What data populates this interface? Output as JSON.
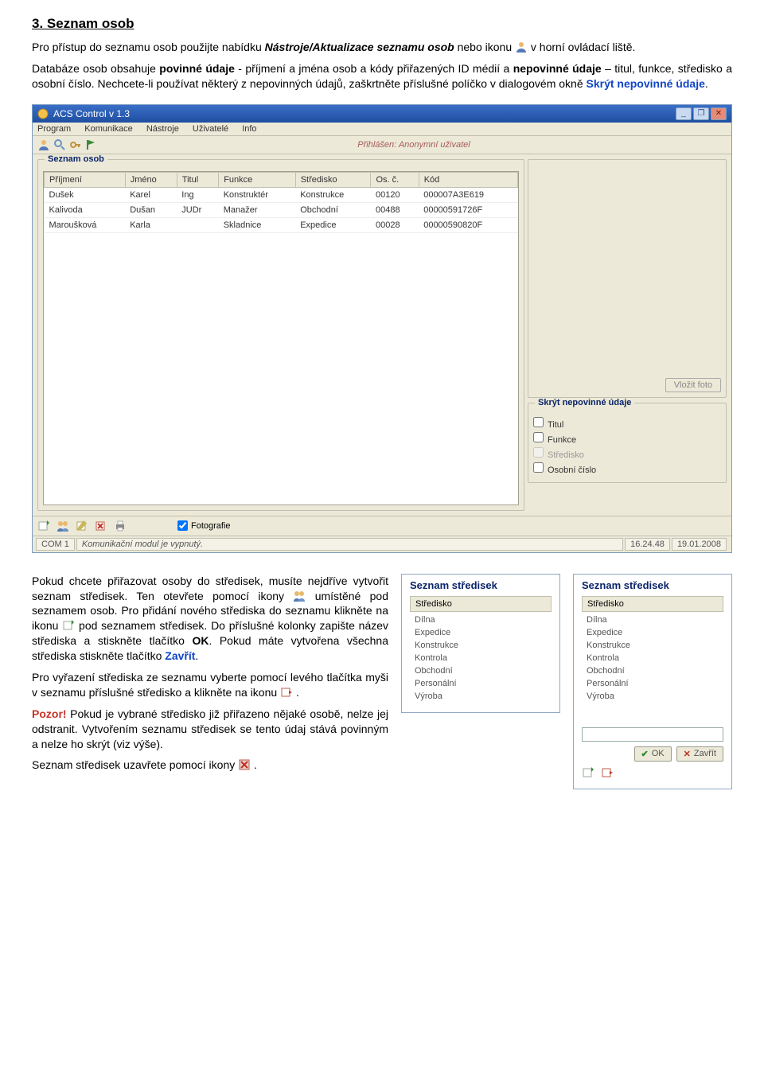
{
  "doc": {
    "heading": "3. Seznam osob",
    "p1a": "Pro přístup do seznamu osob použijte nabídku ",
    "p1menu": "Nástroje/Aktualizace seznamu osob",
    "p1b": " nebo ikonu ",
    "p1c": " v horní ovládací liště.",
    "p2a": "Databáze osob obsahuje ",
    "p2b": "povinné údaje",
    "p2c": " - příjmení a jména osob a kódy přiřazených ID médií a ",
    "p2d": "nepovinné údaje",
    "p2e": " – titul, funkce, středisko a osobní číslo. Nechcete-li používat některý z nepovinných údajů, zaškrtněte příslušné políčko v dialogovém okně ",
    "p2link": "Skrýt nepovinné údaje",
    "p2f": ".",
    "p3a": "Pokud chcete přiřazovat osoby do středisek, musíte nejdříve vytvořit seznam středisek. Ten otevřete pomocí ikony ",
    "p3b": " umístěné pod seznamem osob. Pro přidání nového střediska do seznamu klikněte na ikonu ",
    "p3c": " pod seznamem středisek. Do příslušné kolonky zapište název střediska a stiskněte tlačítko ",
    "p3ok": "OK",
    "p3d": ". Pokud máte vytvořena všechna střediska stiskněte tlačítko ",
    "p3close": "Zavřít",
    "p3e": ".",
    "p4a": "Pro vyřazení střediska ze seznamu vyberte pomocí levého tlačítka myši v seznamu příslušné středisko a klikněte na ikonu ",
    "p4b": ".",
    "p5w": "Pozor!",
    "p5a": " Pokud je vybrané středisko již přiřazeno nějaké osobě, nelze jej odstranit. Vytvořením seznamu středisek se tento údaj stává povinným a nelze ho skrýt (viz výše).",
    "p6a": "Seznam středisek uzavřete pomocí ikony ",
    "p6b": "."
  },
  "app": {
    "title": "ACS Control v 1.3",
    "menus": [
      "Program",
      "Komunikace",
      "Nástroje",
      "Uživatelé",
      "Info"
    ],
    "login": "Přihlášen: Anonymní uživatel",
    "panel_title": "Seznam osob",
    "cols": [
      "Příjmení",
      "Jméno",
      "Titul",
      "Funkce",
      "Středisko",
      "Os. č.",
      "Kód"
    ],
    "rows": [
      [
        "Dušek",
        "Karel",
        "Ing",
        "Konstruktér",
        "Konstrukce",
        "00120",
        "000007A3E619"
      ],
      [
        "Kalivoda",
        "Dušan",
        "JUDr",
        "Manažer",
        "Obchodní",
        "00488",
        "00000591726F"
      ],
      [
        "Maroušková",
        "Karla",
        "",
        "Skladnice",
        "Expedice",
        "00028",
        "00000590820F"
      ]
    ],
    "photo_btn": "Vložit foto",
    "hide_title": "Skrýt nepovinné údaje",
    "hide_opts": [
      {
        "label": "Titul",
        "disabled": false
      },
      {
        "label": "Funkce",
        "disabled": false
      },
      {
        "label": "Středisko",
        "disabled": true
      },
      {
        "label": "Osobní číslo",
        "disabled": false
      }
    ],
    "fot_chk": "Fotografie",
    "status": {
      "com": "COM 1",
      "msg": "Komunikační modul je vypnutý.",
      "time": "16.24.48",
      "date": "19.01.2008"
    }
  },
  "centers": {
    "title": "Seznam středisek",
    "col": "Středisko",
    "items": [
      "Dílna",
      "Expedice",
      "Konstrukce",
      "Kontrola",
      "Obchodní",
      "Personální",
      "Výroba"
    ],
    "ok": "OK",
    "close": "Zavřít"
  }
}
